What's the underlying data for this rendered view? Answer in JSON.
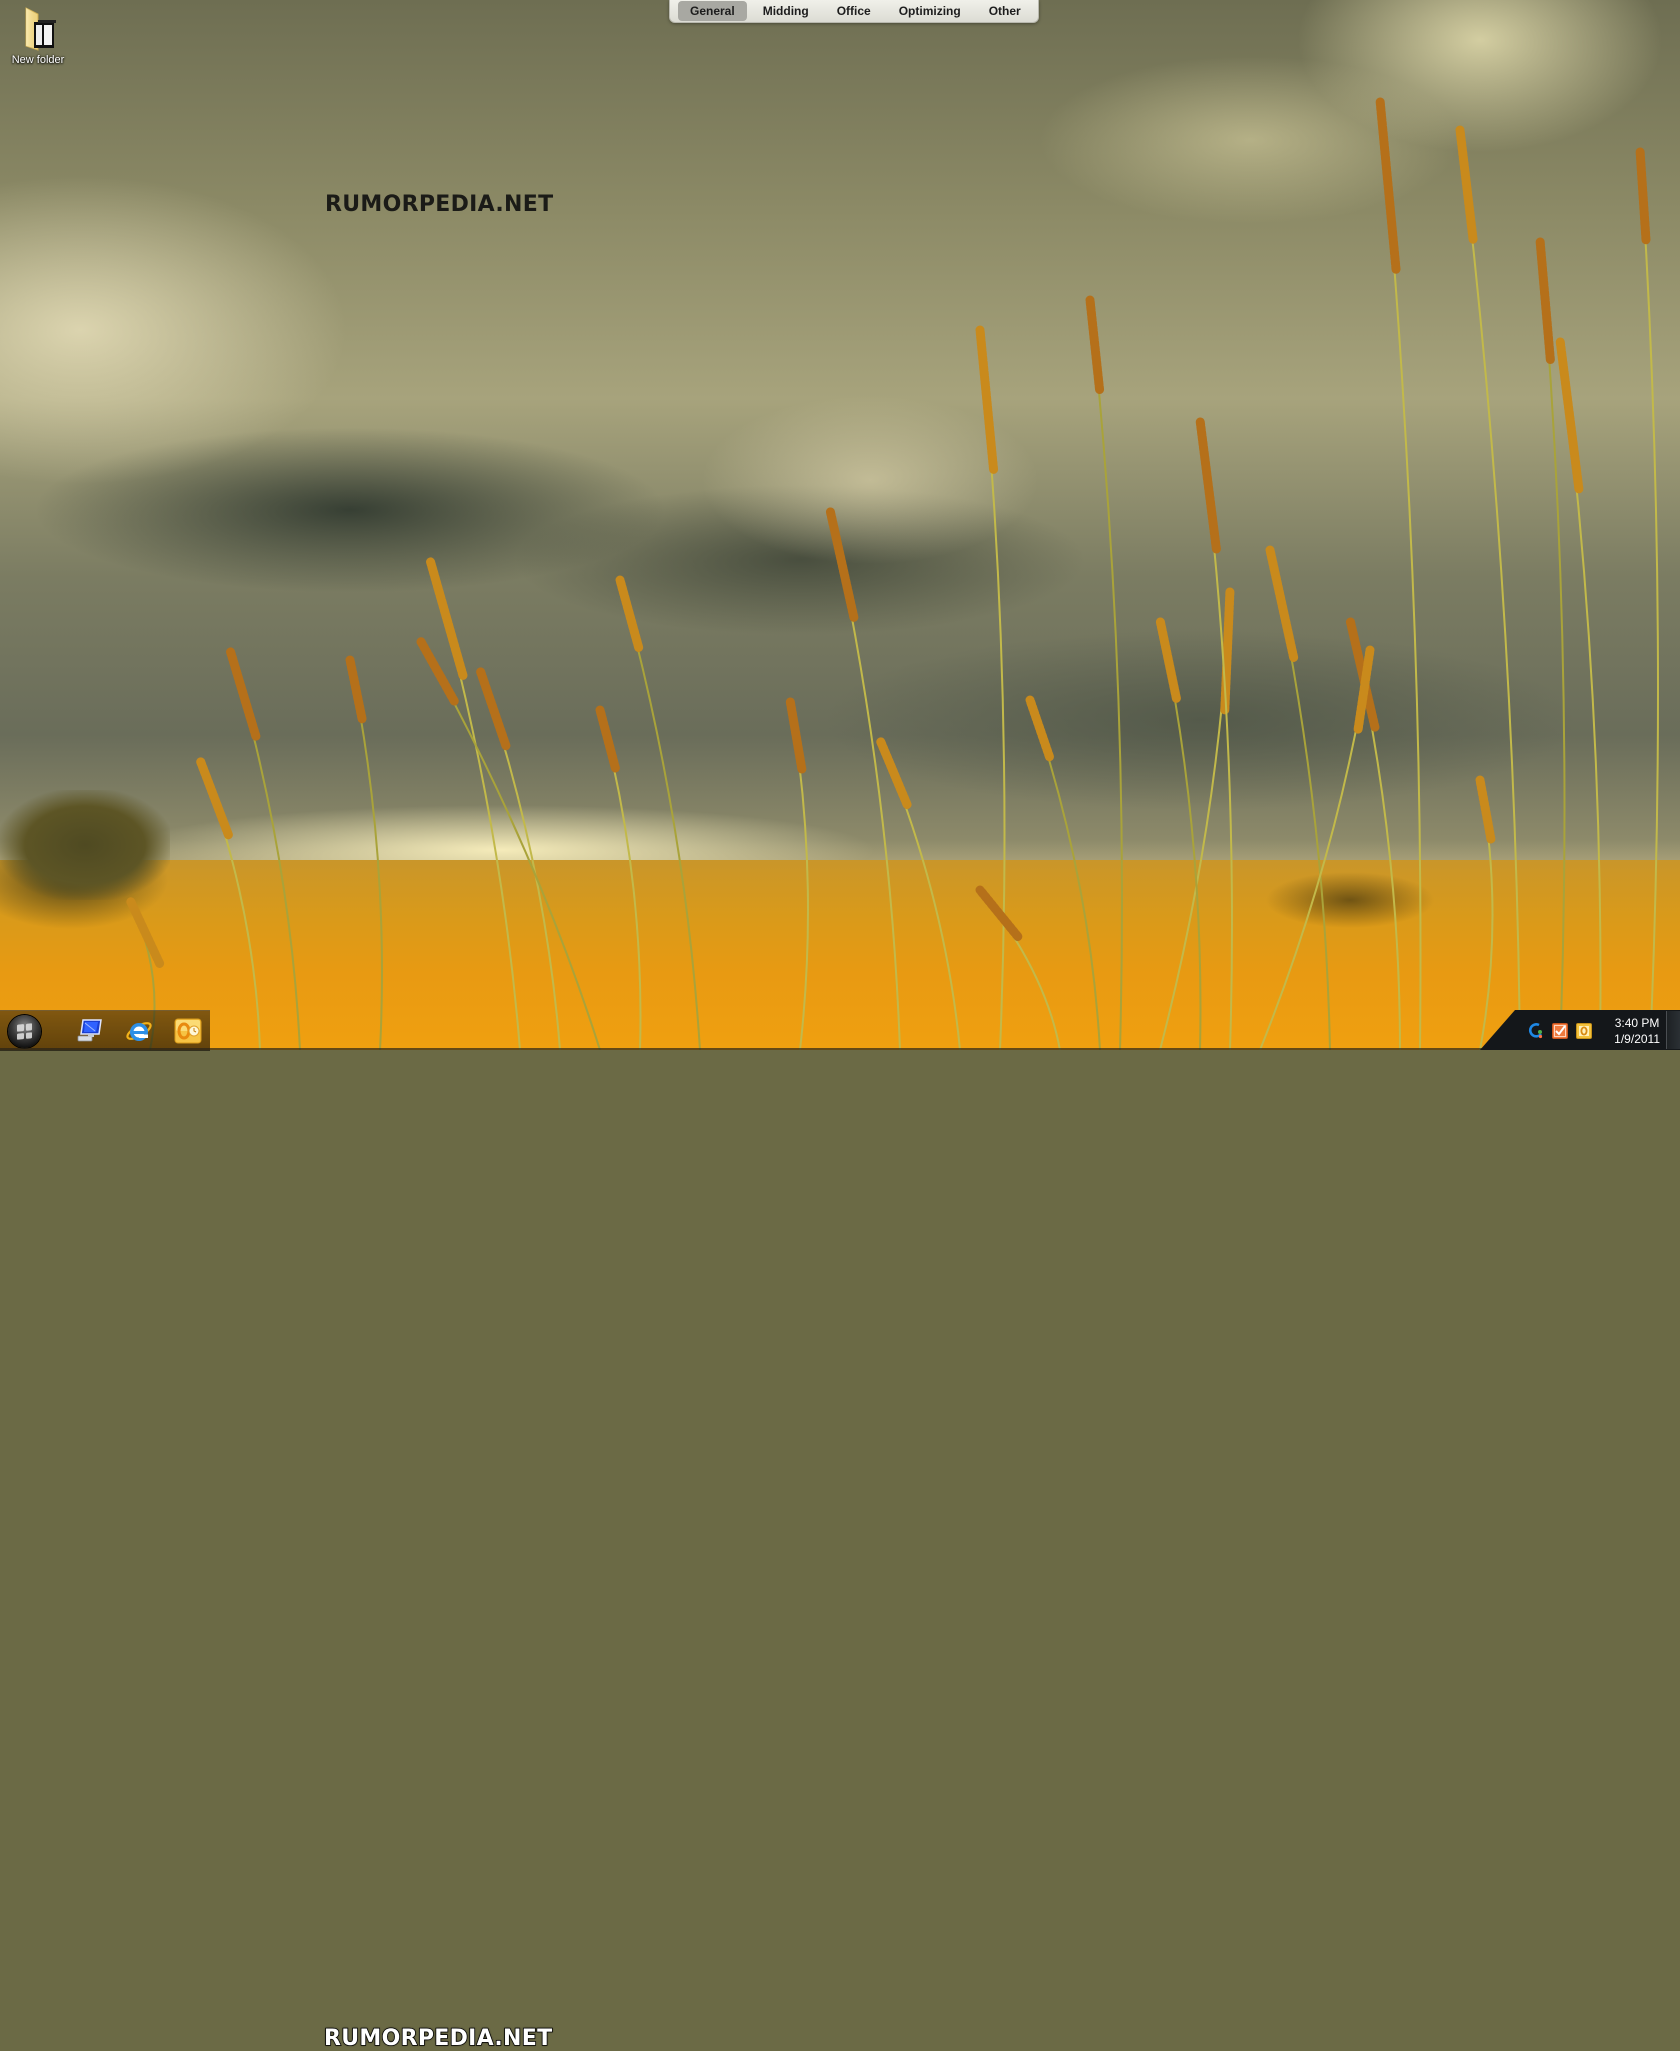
{
  "dock": {
    "tabs": [
      {
        "label": "General",
        "active": true
      },
      {
        "label": "Midding",
        "active": false
      },
      {
        "label": "Office",
        "active": false
      },
      {
        "label": "Optimizing",
        "active": false
      },
      {
        "label": "Other",
        "active": false
      }
    ]
  },
  "desktop": {
    "icons": [
      {
        "label": "New folder",
        "icon": "folder-icon"
      }
    ],
    "watermark_top": "RUMORPEDIA.NET",
    "watermark_bottom": "RUMORPEDIA.NET"
  },
  "taskbar": {
    "start_icon": "windows-orb-icon",
    "pinned": [
      {
        "name": "computer-network-icon"
      },
      {
        "name": "internet-explorer-icon"
      },
      {
        "name": "outlook-icon"
      }
    ],
    "tray": [
      {
        "name": "network-activity-icon"
      },
      {
        "name": "checkmark-task-icon"
      },
      {
        "name": "outlook-reminder-icon"
      }
    ],
    "clock": {
      "time": "3:40 PM",
      "date": "1/9/2011"
    }
  }
}
